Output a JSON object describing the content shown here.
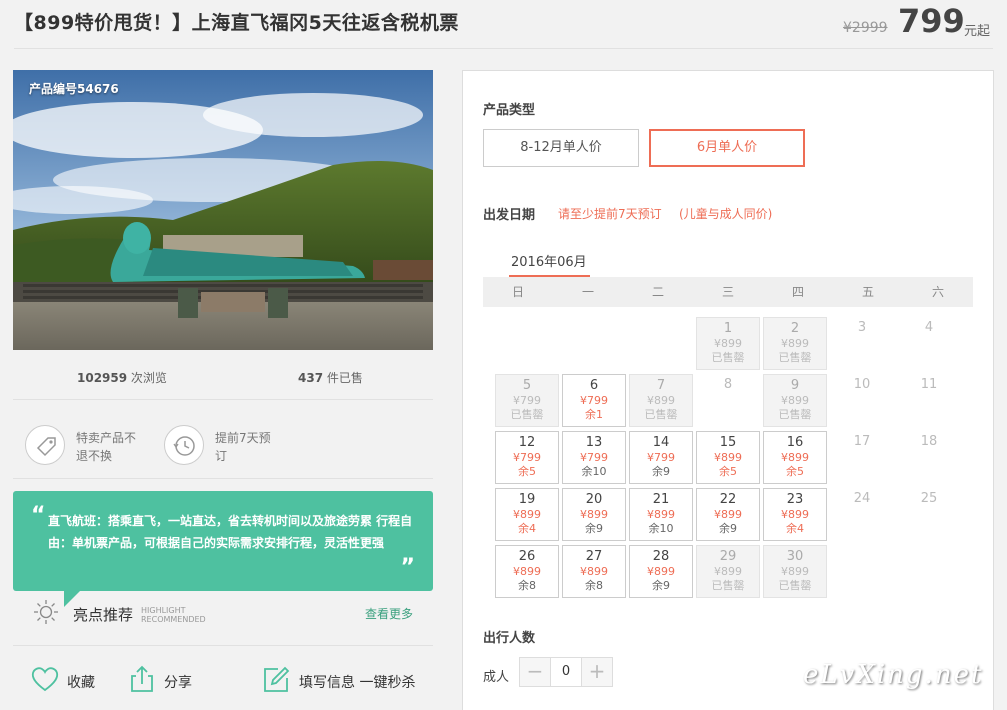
{
  "header": {
    "title": "【899特价甩货！】上海直飞福冈5天往返含税机票",
    "original_price": "¥2999",
    "price": "799",
    "price_unit": "元起"
  },
  "photo": {
    "code_label": "产品编号54676"
  },
  "stats": {
    "views_count": "102959",
    "views_label": " 次浏览",
    "sold_count": "437",
    "sold_label": " 件已售"
  },
  "features": [
    {
      "icon": "tag-icon",
      "text": "特卖产品不退不换"
    },
    {
      "icon": "clock-icon",
      "text": "提前7天预订"
    }
  ],
  "highlight": {
    "open_quote": "“",
    "close_quote": "”",
    "text": "直飞航班：搭乘直飞，一站直达，省去转机时间以及旅途劳累 行程自由：单机票产品，可根据自己的实际需求安排行程，灵活性更强",
    "title": "亮点推荐",
    "en1": "HIGHLIGHT",
    "en2": "RECOMMENDED",
    "more": "查看更多"
  },
  "actions": {
    "favorite": "收藏",
    "share": "分享",
    "fill_info": "填写信息 一键秒杀"
  },
  "booking": {
    "product_type_label": "产品类型",
    "options": [
      "8-12月单人价",
      "6月单人价"
    ],
    "selected_option": "6月单人价",
    "date_label": "出发日期",
    "note1": "请至少提前7天预订",
    "note2": "(儿童与成人同价)",
    "month": "2016年06月",
    "weekdays": [
      "日",
      "一",
      "二",
      "三",
      "四",
      "五",
      "六"
    ],
    "days": [
      {
        "d": "1",
        "p": "¥899",
        "r": "已售罄",
        "s": "soldout"
      },
      {
        "d": "2",
        "p": "¥899",
        "r": "已售罄",
        "s": "soldout"
      },
      {
        "d": "3",
        "p": "",
        "r": "",
        "s": "plain"
      },
      {
        "d": "4",
        "p": "",
        "r": "",
        "s": "plain"
      },
      {
        "d": "5",
        "p": "¥799",
        "r": "已售罄",
        "s": "soldout"
      },
      {
        "d": "6",
        "p": "¥799",
        "r": "余1",
        "s": "avail",
        "red": true
      },
      {
        "d": "7",
        "p": "¥899",
        "r": "已售罄",
        "s": "soldout"
      },
      {
        "d": "8",
        "p": "",
        "r": "",
        "s": "plain"
      },
      {
        "d": "9",
        "p": "¥899",
        "r": "已售罄",
        "s": "soldout"
      },
      {
        "d": "10",
        "p": "",
        "r": "",
        "s": "plain"
      },
      {
        "d": "11",
        "p": "",
        "r": "",
        "s": "plain"
      },
      {
        "d": "12",
        "p": "¥799",
        "r": "余5",
        "s": "avail",
        "red": true
      },
      {
        "d": "13",
        "p": "¥799",
        "r": "余10",
        "s": "avail"
      },
      {
        "d": "14",
        "p": "¥799",
        "r": "余9",
        "s": "avail"
      },
      {
        "d": "15",
        "p": "¥899",
        "r": "余5",
        "s": "avail",
        "red": true
      },
      {
        "d": "16",
        "p": "¥899",
        "r": "余5",
        "s": "avail",
        "red": true
      },
      {
        "d": "17",
        "p": "",
        "r": "",
        "s": "plain"
      },
      {
        "d": "18",
        "p": "",
        "r": "",
        "s": "plain"
      },
      {
        "d": "19",
        "p": "¥899",
        "r": "余4",
        "s": "avail",
        "red": true
      },
      {
        "d": "20",
        "p": "¥899",
        "r": "余9",
        "s": "avail"
      },
      {
        "d": "21",
        "p": "¥899",
        "r": "余10",
        "s": "avail"
      },
      {
        "d": "22",
        "p": "¥899",
        "r": "余9",
        "s": "avail"
      },
      {
        "d": "23",
        "p": "¥899",
        "r": "余4",
        "s": "avail",
        "red": true
      },
      {
        "d": "24",
        "p": "",
        "r": "",
        "s": "plain"
      },
      {
        "d": "25",
        "p": "",
        "r": "",
        "s": "plain"
      },
      {
        "d": "26",
        "p": "¥899",
        "r": "余8",
        "s": "avail"
      },
      {
        "d": "27",
        "p": "¥899",
        "r": "余8",
        "s": "avail"
      },
      {
        "d": "28",
        "p": "¥899",
        "r": "余9",
        "s": "avail"
      },
      {
        "d": "29",
        "p": "¥899",
        "r": "已售罄",
        "s": "soldout"
      },
      {
        "d": "30",
        "p": "¥899",
        "r": "已售罄",
        "s": "soldout"
      }
    ],
    "first_weekday": 3,
    "people_label": "出行人数",
    "adult_label": "成人",
    "minus": "−",
    "plus": "+",
    "adult_count": "0"
  },
  "watermark": "eLvXing.net",
  "colors": {
    "accent": "#ee6d55",
    "green": "#4ec1a0"
  }
}
